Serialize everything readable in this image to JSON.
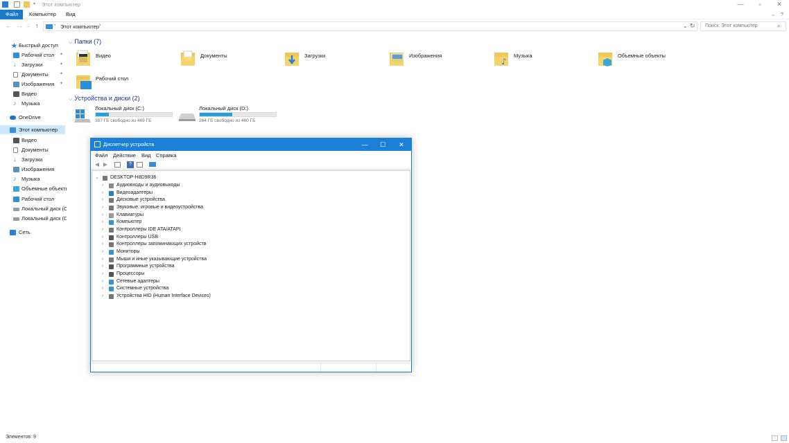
{
  "window": {
    "title": "Этот компьютер"
  },
  "ribbon": {
    "tabs": [
      "Файл",
      "Компьютер",
      "Вид"
    ]
  },
  "address": {
    "path": "Этот компьютер",
    "search_placeholder": "Поиск: Этот компьютер"
  },
  "sidebar": {
    "items": [
      {
        "label": "Быстрый доступ",
        "icon": "star-icon",
        "color": "#2a7fd4"
      },
      {
        "label": "Рабочий стол",
        "icon": "desktop-icon",
        "color": "#2a8fd8",
        "pinned": true
      },
      {
        "label": "Загрузки",
        "icon": "download-icon",
        "color": "#2a7fd4",
        "pinned": true
      },
      {
        "label": "Документы",
        "icon": "documents-icon",
        "color": "#8a8a8a",
        "pinned": true
      },
      {
        "label": "Изображения",
        "icon": "pictures-icon",
        "color": "#5f8fb4",
        "pinned": true
      },
      {
        "label": "Видео",
        "icon": "video-icon",
        "color": "#555555"
      },
      {
        "label": "Музыка",
        "icon": "music-icon",
        "color": "#2a7fd4"
      },
      {
        "label": "OneDrive",
        "icon": "cloud-icon",
        "color": "#1f73c8"
      },
      {
        "label": "Этот компьютер",
        "icon": "computer-icon",
        "color": "#3a8fd8",
        "selected": true
      },
      {
        "label": "Видео",
        "icon": "video-icon",
        "color": "#555555"
      },
      {
        "label": "Документы",
        "icon": "documents-icon",
        "color": "#8a8a8a"
      },
      {
        "label": "Загрузки",
        "icon": "download-icon",
        "color": "#2a7fd4"
      },
      {
        "label": "Изображения",
        "icon": "pictures-icon",
        "color": "#5f8fb4"
      },
      {
        "label": "Музыка",
        "icon": "music-icon",
        "color": "#2a7fd4"
      },
      {
        "label": "Объемные объекты",
        "icon": "3d-objects-icon",
        "color": "#3aa9d8"
      },
      {
        "label": "Рабочий стол",
        "icon": "desktop-icon",
        "color": "#2a8fd8"
      },
      {
        "label": "Локальный диск (C",
        "icon": "drive-icon",
        "color": "#9a9a9a"
      },
      {
        "label": "Локальный диск (D",
        "icon": "drive-icon",
        "color": "#9a9a9a"
      },
      {
        "label": "Сеть",
        "icon": "network-icon",
        "color": "#2a7fd4"
      }
    ]
  },
  "folders_section": {
    "title": "Папки (7)",
    "items": [
      {
        "label": "Видео",
        "icon": "video-folder-icon",
        "accent": "#333333"
      },
      {
        "label": "Документы",
        "icon": "documents-folder-icon",
        "accent": "#d8d8d8"
      },
      {
        "label": "Загрузки",
        "icon": "downloads-folder-icon",
        "accent": "#2a7fd4"
      },
      {
        "label": "Изображения",
        "icon": "pictures-folder-icon",
        "accent": "#5f9fd0"
      },
      {
        "label": "Музыка",
        "icon": "music-folder-icon",
        "accent": "#2a7fd4"
      },
      {
        "label": "Объемные объекты",
        "icon": "3d-objects-folder-icon",
        "accent": "#3aa9d8"
      },
      {
        "label": "Рабочий стол",
        "icon": "desktop-folder-icon",
        "accent": "#2a8fd8"
      }
    ]
  },
  "drives_section": {
    "title": "Устройства и диски (2)",
    "items": [
      {
        "label": "Локальный диск (C:)",
        "free_text": "387 ГБ свободно из 469 ГБ",
        "used_fraction": 0.17
      },
      {
        "label": "Локальный диск (D:)",
        "free_text": "264 ГБ свободно из 460 ГБ",
        "used_fraction": 0.43
      }
    ]
  },
  "status": {
    "text": "Элементов: 9"
  },
  "devmgr": {
    "title": "Диспетчер устройств",
    "menu": [
      "Файл",
      "Действие",
      "Вид",
      "Справка"
    ],
    "root": "DESKTOP-H8D9R36",
    "nodes": [
      {
        "label": "Аудиовходы и аудиовыходы",
        "icon": "audio-icon",
        "color": "#888888"
      },
      {
        "label": "Видеоадаптеры",
        "icon": "display-adapter-icon",
        "color": "#2e7dbf"
      },
      {
        "label": "Дисковые устройства",
        "icon": "disk-drive-icon",
        "color": "#777777"
      },
      {
        "label": "Звуковые, игровые и видеоустройства",
        "icon": "sound-icon",
        "color": "#777777"
      },
      {
        "label": "Клавиатуры",
        "icon": "keyboard-icon",
        "color": "#999999"
      },
      {
        "label": "Компьютер",
        "icon": "computer-icon",
        "color": "#3a8fd8"
      },
      {
        "label": "Контроллеры IDE ATA/ATAPI",
        "icon": "ide-controller-icon",
        "color": "#777777"
      },
      {
        "label": "Контроллеры USB",
        "icon": "usb-icon",
        "color": "#555555"
      },
      {
        "label": "Контроллеры запоминающих устройств",
        "icon": "storage-controller-icon",
        "color": "#777777"
      },
      {
        "label": "Мониторы",
        "icon": "monitor-icon",
        "color": "#3a8fd8"
      },
      {
        "label": "Мыши и иные указывающие устройства",
        "icon": "mouse-icon",
        "color": "#777777"
      },
      {
        "label": "Программные устройства",
        "icon": "software-device-icon",
        "color": "#555555"
      },
      {
        "label": "Процессоры",
        "icon": "processor-icon",
        "color": "#555555"
      },
      {
        "label": "Сетевые адаптеры",
        "icon": "network-adapter-icon",
        "color": "#3a8fd8"
      },
      {
        "label": "Системные устройства",
        "icon": "system-device-icon",
        "color": "#3a8fd8"
      },
      {
        "label": "Устройства HID (Human Interface Devices)",
        "icon": "hid-icon",
        "color": "#777777"
      }
    ]
  }
}
